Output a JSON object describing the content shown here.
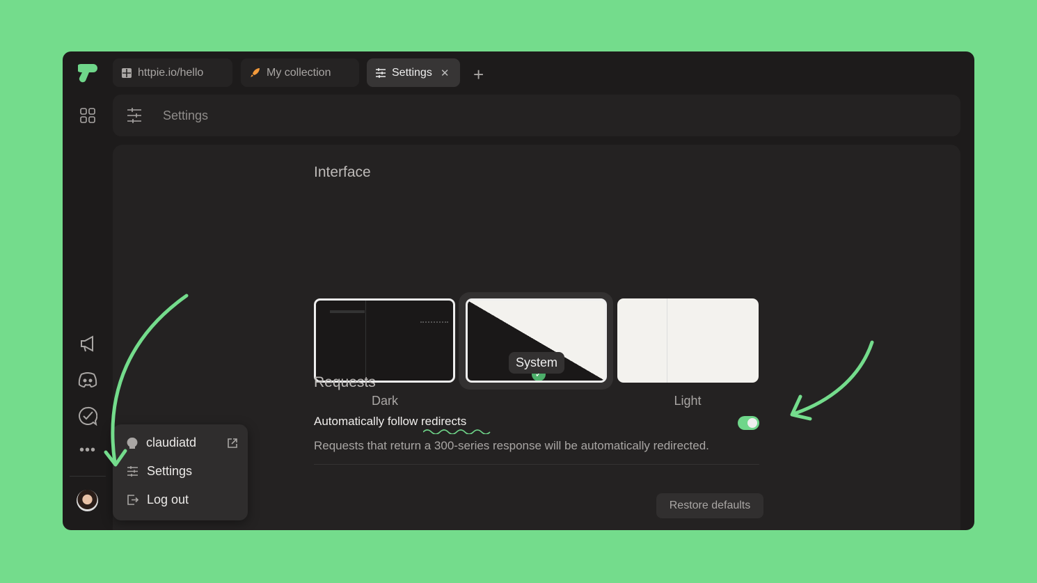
{
  "tabs": [
    {
      "label": "httpie.io/hello",
      "icon": "grid-icon"
    },
    {
      "label": "My collection",
      "icon": "rocket-icon"
    },
    {
      "label": "Settings",
      "icon": "sliders-icon",
      "active": true
    }
  ],
  "header": {
    "title": "Settings"
  },
  "interface": {
    "title": "Interface",
    "themes": [
      {
        "label": "Dark"
      },
      {
        "label": "System",
        "selected": true
      },
      {
        "label": "Light"
      }
    ]
  },
  "requests": {
    "title": "Requests",
    "follow_redirects": {
      "label": "Automatically follow redirects",
      "description": "Requests that return a 300-series response will be automatically redirected.",
      "enabled": true
    }
  },
  "restore_label": "Restore defaults",
  "user_menu": {
    "username": "claudiatd",
    "settings": "Settings",
    "logout": "Log out"
  },
  "colors": {
    "accent": "#6fd68a",
    "background": "#74dc8c",
    "window": "#1d1b1b"
  }
}
